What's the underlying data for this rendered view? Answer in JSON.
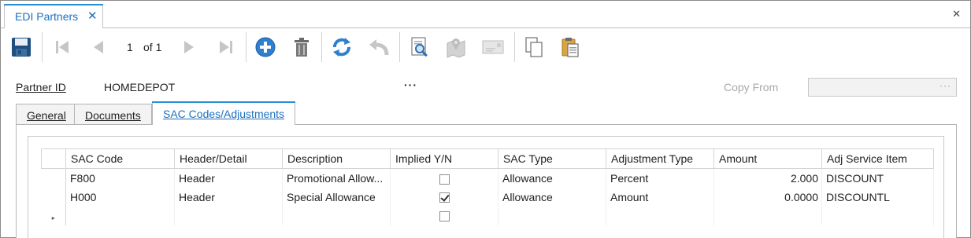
{
  "window": {
    "tab_title": "EDI Partners",
    "tab_close_glyph": "✕",
    "close_glyph": "✕"
  },
  "toolbar": {
    "buttons": [
      "save-icon",
      "first-record-icon",
      "previous-record-icon",
      "next-record-icon",
      "last-record-icon",
      "add-icon",
      "delete-icon",
      "refresh-icon",
      "undo-icon",
      "search-document-icon",
      "map-icon",
      "envelope-icon",
      "copy-icon",
      "paste-icon"
    ],
    "pager": {
      "current": "1",
      "of_text": "of 1"
    }
  },
  "partner": {
    "label": "Partner ID",
    "value": "HOMEDEPOT",
    "lookup_glyph": "···",
    "copy_from_label": "Copy From",
    "copy_from_value": "",
    "copy_from_glyph": "···"
  },
  "tabs": [
    {
      "label": "General",
      "active": false
    },
    {
      "label": "Documents",
      "active": false
    },
    {
      "label": "SAC Codes/Adjustments",
      "active": true
    }
  ],
  "grid": {
    "columns": [
      "SAC Code",
      "Header/Detail",
      "Description",
      "Implied Y/N",
      "SAC Type",
      "Adjustment Type",
      "Amount",
      "Adj Service Item"
    ],
    "rows": [
      {
        "sac_code": "F800",
        "header_detail": "Header",
        "description": "Promotional Allow...",
        "implied": false,
        "sac_type": "Allowance",
        "adjustment_type": "Percent",
        "amount": "2.000",
        "adj_service_item": "DISCOUNT"
      },
      {
        "sac_code": "H000",
        "header_detail": "Header",
        "description": "Special Allowance",
        "implied": true,
        "sac_type": "Allowance",
        "adjustment_type": "Amount",
        "amount": "0.0000",
        "adj_service_item": "DISCOUNTL"
      }
    ],
    "new_row_indicator": "▸"
  },
  "colors": {
    "accent": "#2b8fd6",
    "tab_text": "#1d6fbf",
    "disabled_text": "#a8a8a8"
  }
}
